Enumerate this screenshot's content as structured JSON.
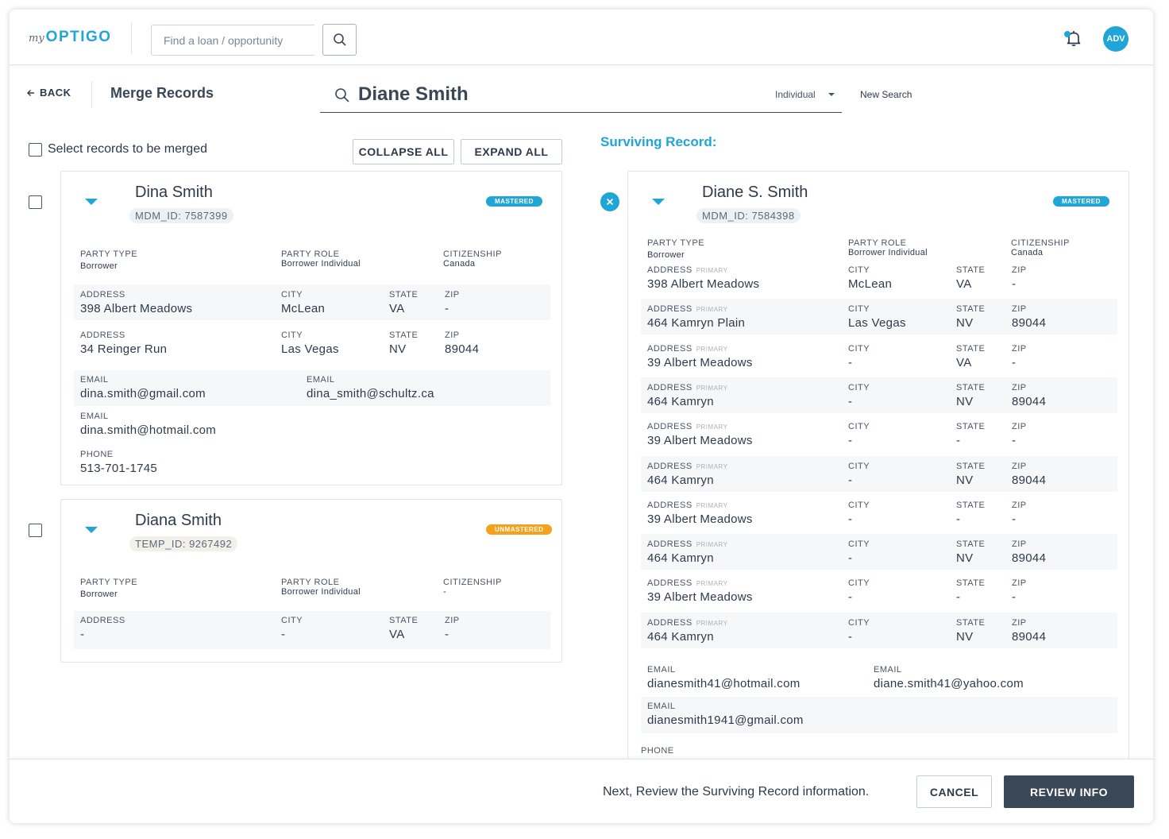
{
  "topbar": {
    "logo_prefix": "my",
    "logo_brand": "OPTIGO",
    "search_placeholder": "Find a loan / opportunity",
    "avatar_initials": "ADV"
  },
  "header": {
    "back_label": "BACK",
    "title": "Merge Records",
    "search_query": "Diane Smith",
    "search_type": "Individual",
    "new_search_label": "New Search"
  },
  "left": {
    "select_label": "Select records to be merged",
    "collapse_label": "COLLAPSE ALL",
    "expand_label": "EXPAND ALL",
    "records": [
      {
        "name": "Dina Smith",
        "id": "MDM_ID: 7587399",
        "badge": "MASTERED",
        "party_type_label": "PARTY TYPE",
        "party_type": "Borrower",
        "party_role_label": "PARTY ROLE",
        "party_role": "Borrower Individual",
        "citizenship_label": "CITIZENSHIP",
        "citizenship": "Canada",
        "addresses": [
          {
            "address_label": "ADDRESS",
            "address": "398 Albert Meadows",
            "city_label": "CITY",
            "city": "McLean",
            "state_label": "STATE",
            "state": "VA",
            "zip_label": "ZIP",
            "zip": "-"
          },
          {
            "address_label": "ADDRESS",
            "address": "34 Reinger Run",
            "city_label": "CITY",
            "city": "Las Vegas",
            "state_label": "STATE",
            "state": "NV",
            "zip_label": "ZIP",
            "zip": "89044"
          }
        ],
        "emails": [
          {
            "label": "EMAIL",
            "value": "dina.smith@gmail.com"
          },
          {
            "label": "EMAIL",
            "value": "dina_smith@schultz.ca"
          },
          {
            "label": "EMAIL",
            "value": "dina.smith@hotmail.com"
          }
        ],
        "phone_label": "PHONE",
        "phone": "513-701-1745"
      },
      {
        "name": "Diana Smith",
        "id": "TEMP_ID: 9267492",
        "badge": "UNMASTERED",
        "party_type_label": "PARTY TYPE",
        "party_type": "Borrower",
        "party_role_label": "PARTY ROLE",
        "party_role": "Borrower Individual",
        "citizenship_label": "CITIZENSHIP",
        "citizenship": "-",
        "addresses": [
          {
            "address_label": "ADDRESS",
            "address": "-",
            "city_label": "CITY",
            "city": "-",
            "state_label": "STATE",
            "state": "VA",
            "zip_label": "ZIP",
            "zip": "-"
          }
        ]
      }
    ]
  },
  "right": {
    "title": "Surviving Record:",
    "record": {
      "name": "Diane S. Smith",
      "id": "MDM_ID: 7584398",
      "badge": "MASTERED",
      "party_type_label": "PARTY TYPE",
      "party_type": "Borrower",
      "party_role_label": "PARTY ROLE",
      "party_role": "Borrower Individual",
      "citizenship_label": "CITIZENSHIP",
      "citizenship": "Canada",
      "primary_tag": "PRIMARY",
      "addresses": [
        {
          "address_label": "ADDRESS",
          "address": "398 Albert Meadows",
          "city_label": "CITY",
          "city": "McLean",
          "state_label": "STATE",
          "state": "VA",
          "zip_label": "ZIP",
          "zip": "-"
        },
        {
          "address_label": "ADDRESS",
          "address": "464 Kamryn Plain",
          "city_label": "CITY",
          "city": "Las Vegas",
          "state_label": "STATE",
          "state": "NV",
          "zip_label": "ZIP",
          "zip": "89044"
        },
        {
          "address_label": "ADDRESS",
          "address": "39 Albert Meadows",
          "city_label": "CITY",
          "city": "-",
          "state_label": "STATE",
          "state": "VA",
          "zip_label": "ZIP",
          "zip": "-"
        },
        {
          "address_label": "ADDRESS",
          "address": "464 Kamryn",
          "city_label": "CITY",
          "city": "-",
          "state_label": "STATE",
          "state": "NV",
          "zip_label": "ZIP",
          "zip": "89044"
        },
        {
          "address_label": "ADDRESS",
          "address": "39 Albert Meadows",
          "city_label": "CITY",
          "city": "-",
          "state_label": "STATE",
          "state": "-",
          "zip_label": "ZIP",
          "zip": "-"
        },
        {
          "address_label": "ADDRESS",
          "address": "464 Kamryn",
          "city_label": "CITY",
          "city": "-",
          "state_label": "STATE",
          "state": "NV",
          "zip_label": "ZIP",
          "zip": "89044"
        },
        {
          "address_label": "ADDRESS",
          "address": "39 Albert Meadows",
          "city_label": "CITY",
          "city": "-",
          "state_label": "STATE",
          "state": "-",
          "zip_label": "ZIP",
          "zip": "-"
        },
        {
          "address_label": "ADDRESS",
          "address": "464 Kamryn",
          "city_label": "CITY",
          "city": "-",
          "state_label": "STATE",
          "state": "NV",
          "zip_label": "ZIP",
          "zip": "89044"
        },
        {
          "address_label": "ADDRESS",
          "address": "39 Albert Meadows",
          "city_label": "CITY",
          "city": "-",
          "state_label": "STATE",
          "state": "-",
          "zip_label": "ZIP",
          "zip": "-"
        },
        {
          "address_label": "ADDRESS",
          "address": "464 Kamryn",
          "city_label": "CITY",
          "city": "-",
          "state_label": "STATE",
          "state": "NV",
          "zip_label": "ZIP",
          "zip": "89044"
        }
      ],
      "emails": [
        {
          "label": "EMAIL",
          "value": "dianesmith41@hotmail.com"
        },
        {
          "label": "EMAIL",
          "value": "diane.smith41@yahoo.com"
        },
        {
          "label": "EMAIL",
          "value": "dianesmith1941@gmail.com"
        }
      ],
      "phone_label": "PHONE"
    }
  },
  "footer": {
    "message": "Next, Review the Surviving Record information.",
    "cancel_label": "CANCEL",
    "review_label": "REVIEW INFO"
  },
  "colors": {
    "accent": "#1fa5d6",
    "unmastered": "#f4a21e",
    "primary_button": "#3a4757"
  }
}
